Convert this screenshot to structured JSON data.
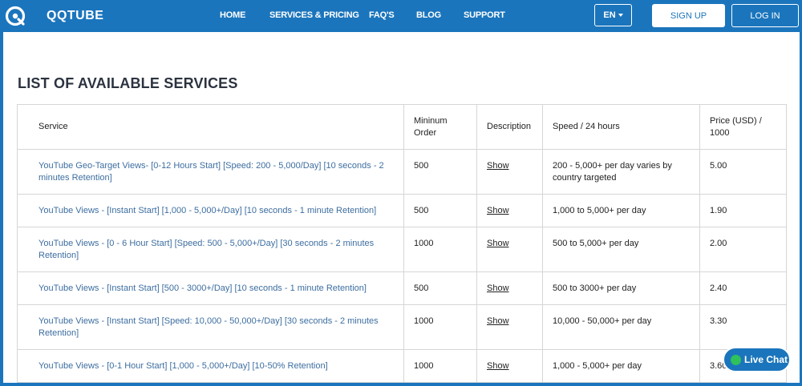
{
  "header": {
    "logo_text": "QQTUBE",
    "logo_icon": "qq-logo-icon",
    "nav": [
      {
        "label": "HOME"
      },
      {
        "label": "SERVICES & PRICING"
      },
      {
        "label": "FAQ'S"
      },
      {
        "label": "BLOG"
      },
      {
        "label": "SUPPORT"
      }
    ],
    "language": "EN",
    "signup_label": "SIGN UP",
    "login_label": "LOG IN"
  },
  "page": {
    "title": "LIST OF AVAILABLE SERVICES"
  },
  "table": {
    "headers": [
      "Service",
      "Mininum Order",
      "Description",
      "Speed / 24 hours",
      "Price (USD) / 1000"
    ],
    "rows": [
      {
        "service": "YouTube Geo-Target Views- [0-12 Hours Start] [Speed: 200 - 5,000/Day] [10 seconds - 2 minutes Retention]",
        "min_order": "500",
        "description": "Show",
        "speed": "200 - 5,000+ per day varies by country targeted",
        "price": "5.00"
      },
      {
        "service": "YouTube Views - [Instant Start] [1,000 - 5,000+/Day] [10 seconds - 1 minute Retention]",
        "min_order": "500",
        "description": "Show",
        "speed": "1,000 to 5,000+ per day",
        "price": "1.90"
      },
      {
        "service": "YouTube Views - [0 - 6 Hour Start] [Speed: 500 - 5,000+/Day] [30 seconds - 2 minutes Retention]",
        "min_order": "1000",
        "description": "Show",
        "speed": "500 to 5,000+ per day",
        "price": "2.00"
      },
      {
        "service": "YouTube Views - [Instant Start] [500 - 3000+/Day] [10 seconds - 1 minute Retention]",
        "min_order": "500",
        "description": "Show",
        "speed": "500 to 3000+ per day",
        "price": "2.40"
      },
      {
        "service": "YouTube Views - [Instant Start] [Speed: 10,000 - 50,000+/Day] [30 seconds - 2 minutes Retention]",
        "min_order": "1000",
        "description": "Show",
        "speed": "10,000 - 50,000+ per day",
        "price": "3.30"
      },
      {
        "service": "YouTube Views - [0-1 Hour Start] [1,000 - 5,000+/Day] [10-50% Retention]",
        "min_order": "1000",
        "description": "Show",
        "speed": "1,000 - 5,000+ per day",
        "price": "3.60"
      }
    ]
  },
  "chat": {
    "label": "Live Chat"
  },
  "colors": {
    "brand_blue": "#1b75bc",
    "link_blue": "#3d6ea0",
    "online_green": "#2fc15b"
  }
}
